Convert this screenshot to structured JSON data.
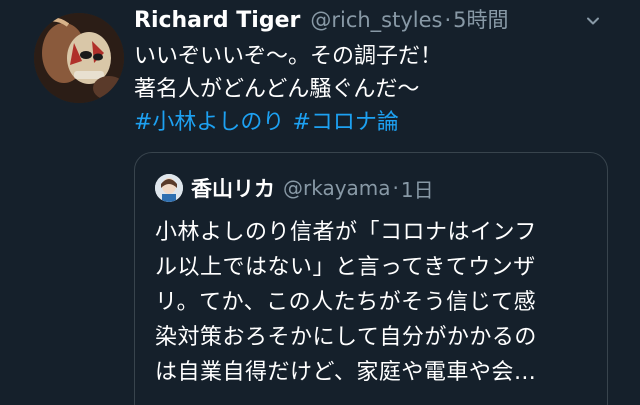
{
  "tweet": {
    "display_name": "Richard Tiger",
    "handle": "@rich_styles",
    "separator": "·",
    "time": "5時間",
    "text_lines": [
      "いいぞいいぞ〜。その調子だ！",
      "著名人がどんどん騒ぐんだ〜"
    ],
    "hashtags": [
      "#小林よしのり",
      "#コロナ論"
    ],
    "menu_icon": "chevron-down-icon"
  },
  "quoted_tweet": {
    "display_name": "香山リカ",
    "handle": "@rkayama",
    "separator": "·",
    "time": "1日",
    "text_lines": [
      "小林よしのり信者が「コロナはインフ",
      "ル以上ではない」と言ってきてウンザ",
      "リ。てか、この人たちがそう信じて感",
      "染対策おろそかにして自分がかかるの",
      "は自業自得だけど、家庭や電車や会…"
    ]
  },
  "colors": {
    "background": "#15202b",
    "link": "#1da1f2",
    "secondary_text": "#8899a6",
    "border": "#38444d"
  }
}
